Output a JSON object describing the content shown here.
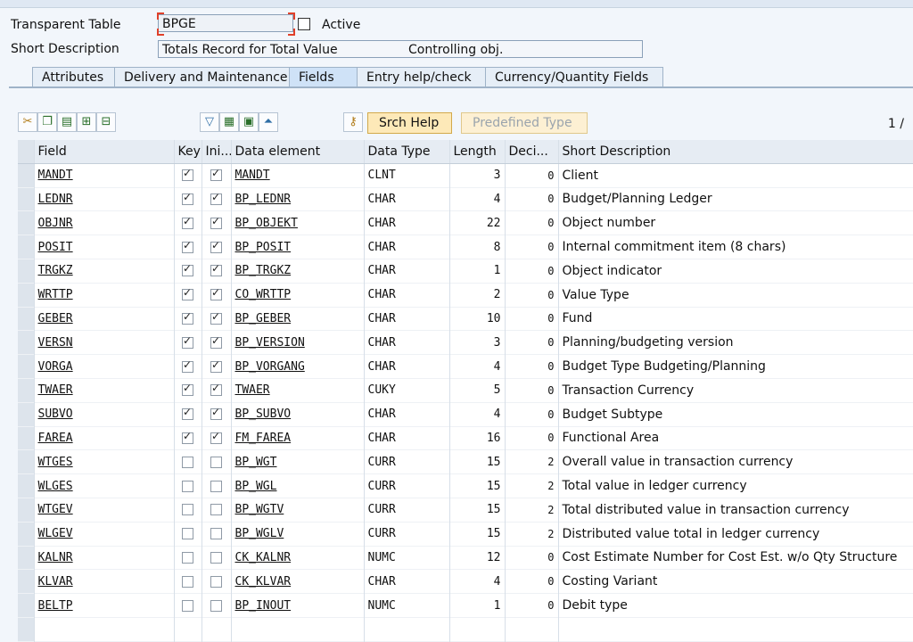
{
  "header": {
    "table_type_label": "Transparent Table",
    "table_name": "BPGE",
    "status": "Active",
    "short_desc_label": "Short Description",
    "short_desc_value": "Totals Record for Total Value",
    "short_desc_extra": "Controlling obj."
  },
  "tabs": [
    {
      "label": "Attributes",
      "active": false
    },
    {
      "label": "Delivery and Maintenance",
      "active": false
    },
    {
      "label": "Fields",
      "active": true
    },
    {
      "label": "Entry help/check",
      "active": false
    },
    {
      "label": "Currency/Quantity Fields",
      "active": false
    }
  ],
  "toolbar": {
    "srch_help": "Srch Help",
    "predefined_type": "Predefined Type",
    "page_indicator": "1 /"
  },
  "grid": {
    "columns": [
      "Field",
      "Key",
      "Ini...",
      "Data element",
      "Data Type",
      "Length",
      "Deci...",
      "Short Description"
    ],
    "rows": [
      {
        "field": "MANDT",
        "key": true,
        "ini": true,
        "element": "MANDT",
        "type": "CLNT",
        "length": "3",
        "deci": "0",
        "desc": "Client"
      },
      {
        "field": "LEDNR",
        "key": true,
        "ini": true,
        "element": "BP_LEDNR",
        "type": "CHAR",
        "length": "4",
        "deci": "0",
        "desc": "Budget/Planning Ledger"
      },
      {
        "field": "OBJNR",
        "key": true,
        "ini": true,
        "element": "BP_OBJEKT",
        "type": "CHAR",
        "length": "22",
        "deci": "0",
        "desc": "Object number"
      },
      {
        "field": "POSIT",
        "key": true,
        "ini": true,
        "element": "BP_POSIT",
        "type": "CHAR",
        "length": "8",
        "deci": "0",
        "desc": "Internal commitment item (8 chars)"
      },
      {
        "field": "TRGKZ",
        "key": true,
        "ini": true,
        "element": "BP_TRGKZ",
        "type": "CHAR",
        "length": "1",
        "deci": "0",
        "desc": "Object indicator"
      },
      {
        "field": "WRTTP",
        "key": true,
        "ini": true,
        "element": "CO_WRTTP",
        "type": "CHAR",
        "length": "2",
        "deci": "0",
        "desc": "Value Type"
      },
      {
        "field": "GEBER",
        "key": true,
        "ini": true,
        "element": "BP_GEBER",
        "type": "CHAR",
        "length": "10",
        "deci": "0",
        "desc": "Fund"
      },
      {
        "field": "VERSN",
        "key": true,
        "ini": true,
        "element": "BP_VERSION",
        "type": "CHAR",
        "length": "3",
        "deci": "0",
        "desc": "Planning/budgeting version"
      },
      {
        "field": "VORGA",
        "key": true,
        "ini": true,
        "element": "BP_VORGANG",
        "type": "CHAR",
        "length": "4",
        "deci": "0",
        "desc": "Budget Type Budgeting/Planning"
      },
      {
        "field": "TWAER",
        "key": true,
        "ini": true,
        "element": "TWAER",
        "type": "CUKY",
        "length": "5",
        "deci": "0",
        "desc": "Transaction Currency"
      },
      {
        "field": "SUBVO",
        "key": true,
        "ini": true,
        "element": "BP_SUBVO",
        "type": "CHAR",
        "length": "4",
        "deci": "0",
        "desc": "Budget Subtype"
      },
      {
        "field": "FAREA",
        "key": true,
        "ini": true,
        "element": "FM_FAREA",
        "type": "CHAR",
        "length": "16",
        "deci": "0",
        "desc": "Functional Area"
      },
      {
        "field": "WTGES",
        "key": false,
        "ini": false,
        "element": "BP_WGT",
        "type": "CURR",
        "length": "15",
        "deci": "2",
        "desc": "Overall value in transaction currency"
      },
      {
        "field": "WLGES",
        "key": false,
        "ini": false,
        "element": "BP_WGL",
        "type": "CURR",
        "length": "15",
        "deci": "2",
        "desc": "Total value in ledger currency"
      },
      {
        "field": "WTGEV",
        "key": false,
        "ini": false,
        "element": "BP_WGTV",
        "type": "CURR",
        "length": "15",
        "deci": "2",
        "desc": "Total distributed value in transaction currency"
      },
      {
        "field": "WLGEV",
        "key": false,
        "ini": false,
        "element": "BP_WGLV",
        "type": "CURR",
        "length": "15",
        "deci": "2",
        "desc": "Distributed value total in ledger currency"
      },
      {
        "field": "KALNR",
        "key": false,
        "ini": false,
        "element": "CK_KALNR",
        "type": "NUMC",
        "length": "12",
        "deci": "0",
        "desc": "Cost Estimate Number for Cost Est. w/o Qty Structure"
      },
      {
        "field": "KLVAR",
        "key": false,
        "ini": false,
        "element": "CK_KLVAR",
        "type": "CHAR",
        "length": "4",
        "deci": "0",
        "desc": "Costing Variant"
      },
      {
        "field": "BELTP",
        "key": false,
        "ini": false,
        "element": "BP_INOUT",
        "type": "NUMC",
        "length": "1",
        "deci": "0",
        "desc": "Debit type"
      }
    ]
  }
}
